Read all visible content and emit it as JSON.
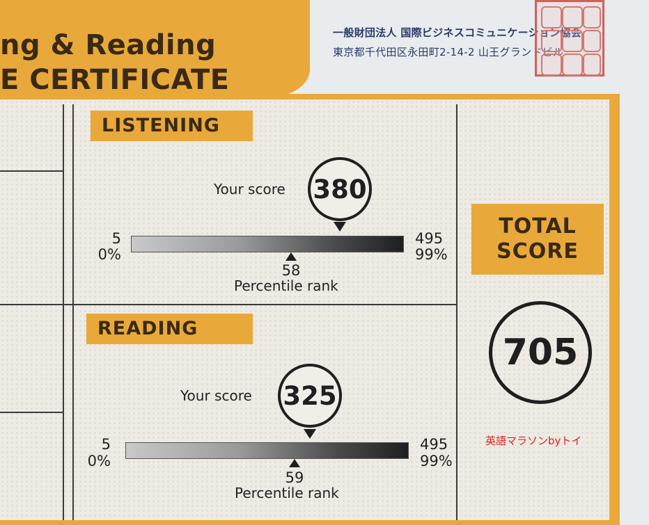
{
  "header": {
    "title_line1": "ng & Reading",
    "title_line2": "E CERTIFICATE"
  },
  "issuer": {
    "name": "一般財団法人 国際ビジネスコミュニケーション協会",
    "address": "東京都千代田区永田町2-14-2 山王グランドビル"
  },
  "listening": {
    "label": "LISTENING",
    "your_score_label": "Your score",
    "score": "380",
    "min_score": "5",
    "min_percent": "0%",
    "max_score": "495",
    "max_percent": "99%",
    "percentile_rank": "58",
    "percentile_label": "Percentile rank",
    "score_fraction": 0.76,
    "rank_fraction": 0.58
  },
  "reading": {
    "label": "READING",
    "your_score_label": "Your score",
    "score": "325",
    "min_score": "5",
    "min_percent": "0%",
    "max_score": "495",
    "max_percent": "99%",
    "percentile_rank": "59",
    "percentile_label": "Percentile rank",
    "score_fraction": 0.65,
    "rank_fraction": 0.59
  },
  "total": {
    "label_line1": "TOTAL",
    "label_line2": "SCORE",
    "score": "705"
  },
  "watermark": "英語マラソンbyトイ",
  "colors": {
    "accent_orange": "#e8a93a",
    "ink": "#1f1f1f",
    "issuer_blue": "#2a3a66",
    "seal_red": "#d0605a",
    "watermark_red": "#e0221c"
  }
}
